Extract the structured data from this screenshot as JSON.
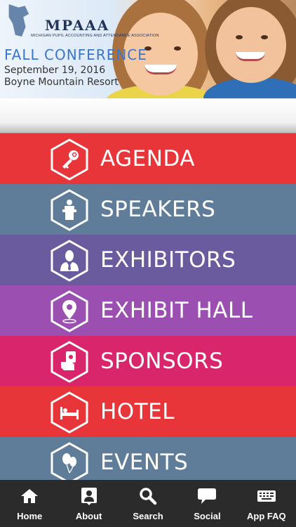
{
  "banner": {
    "logo_text": "MPAAA",
    "logo_subtitle": "MICHIGAN PUPIL ACCOUNTING AND ATTENDANCE ASSOCIATION",
    "title": "FALL CONFERENCE",
    "date": "September 19, 2016",
    "venue": "Boyne Mountain Resort"
  },
  "menu": {
    "items": [
      {
        "label": "AGENDA",
        "color": "#e8353a",
        "icon": "key-icon"
      },
      {
        "label": "SPEAKERS",
        "color": "#5f7d98",
        "icon": "podium-icon"
      },
      {
        "label": "EXHIBITORS",
        "color": "#6a5a9e",
        "icon": "businessman-icon"
      },
      {
        "label": "EXHIBIT HALL",
        "color": "#9a4fb1",
        "icon": "map-pin-icon"
      },
      {
        "label": "SPONSORS",
        "color": "#d9256c",
        "icon": "money-hand-icon"
      },
      {
        "label": "HOTEL",
        "color": "#e8353a",
        "icon": "bed-icon"
      },
      {
        "label": "EVENTS",
        "color": "#5f7d98",
        "icon": "balloons-icon"
      }
    ]
  },
  "tabbar": {
    "tabs": [
      {
        "label": "Home",
        "icon": "home-icon"
      },
      {
        "label": "About",
        "icon": "person-card-icon"
      },
      {
        "label": "Search",
        "icon": "search-icon"
      },
      {
        "label": "Social",
        "icon": "chat-bubble-icon"
      },
      {
        "label": "App FAQ",
        "icon": "keyboard-icon"
      }
    ]
  }
}
